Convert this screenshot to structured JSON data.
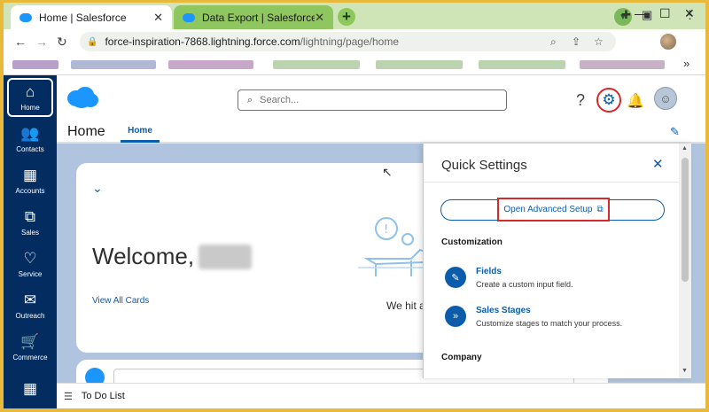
{
  "browser": {
    "tabs": [
      {
        "label": "Home | Salesforce",
        "close": "✕"
      },
      {
        "label": "Data Export | Salesforce",
        "close": "✕"
      }
    ],
    "new_tab": "+",
    "url_host": "force-inspiration-7868.lightning.force.com",
    "url_path": "/lightning/page/home"
  },
  "nav_rail": {
    "items": [
      {
        "label": "Home",
        "icon": "home-icon"
      },
      {
        "label": "Contacts",
        "icon": "contacts-icon"
      },
      {
        "label": "Accounts",
        "icon": "building-icon"
      },
      {
        "label": "Sales",
        "icon": "chart-icon"
      },
      {
        "label": "Service",
        "icon": "heart-icon"
      },
      {
        "label": "Outreach",
        "icon": "mail-icon"
      },
      {
        "label": "Commerce",
        "icon": "cart-icon"
      }
    ]
  },
  "header": {
    "search_placeholder": "Search...",
    "app_name": "Home",
    "tab_label": "Home"
  },
  "main": {
    "welcome": "Welcome,",
    "view_all": "View All Cards",
    "we_hit": "We hit a"
  },
  "todo": {
    "label": "To Do List"
  },
  "quick_settings": {
    "title": "Quick Settings",
    "advanced_setup": "Open Advanced Setup",
    "sections": {
      "customization": "Customization",
      "company": "Company"
    },
    "items": [
      {
        "title": "Fields",
        "desc": "Create a custom input field."
      },
      {
        "title": "Sales Stages",
        "desc": "Customize stages to match your process."
      }
    ]
  },
  "colors": {
    "brand_blue": "#0b5cab",
    "nav_navy": "#032d60",
    "highlight_red": "#d42a2a",
    "content_bg": "#b0c4df"
  }
}
